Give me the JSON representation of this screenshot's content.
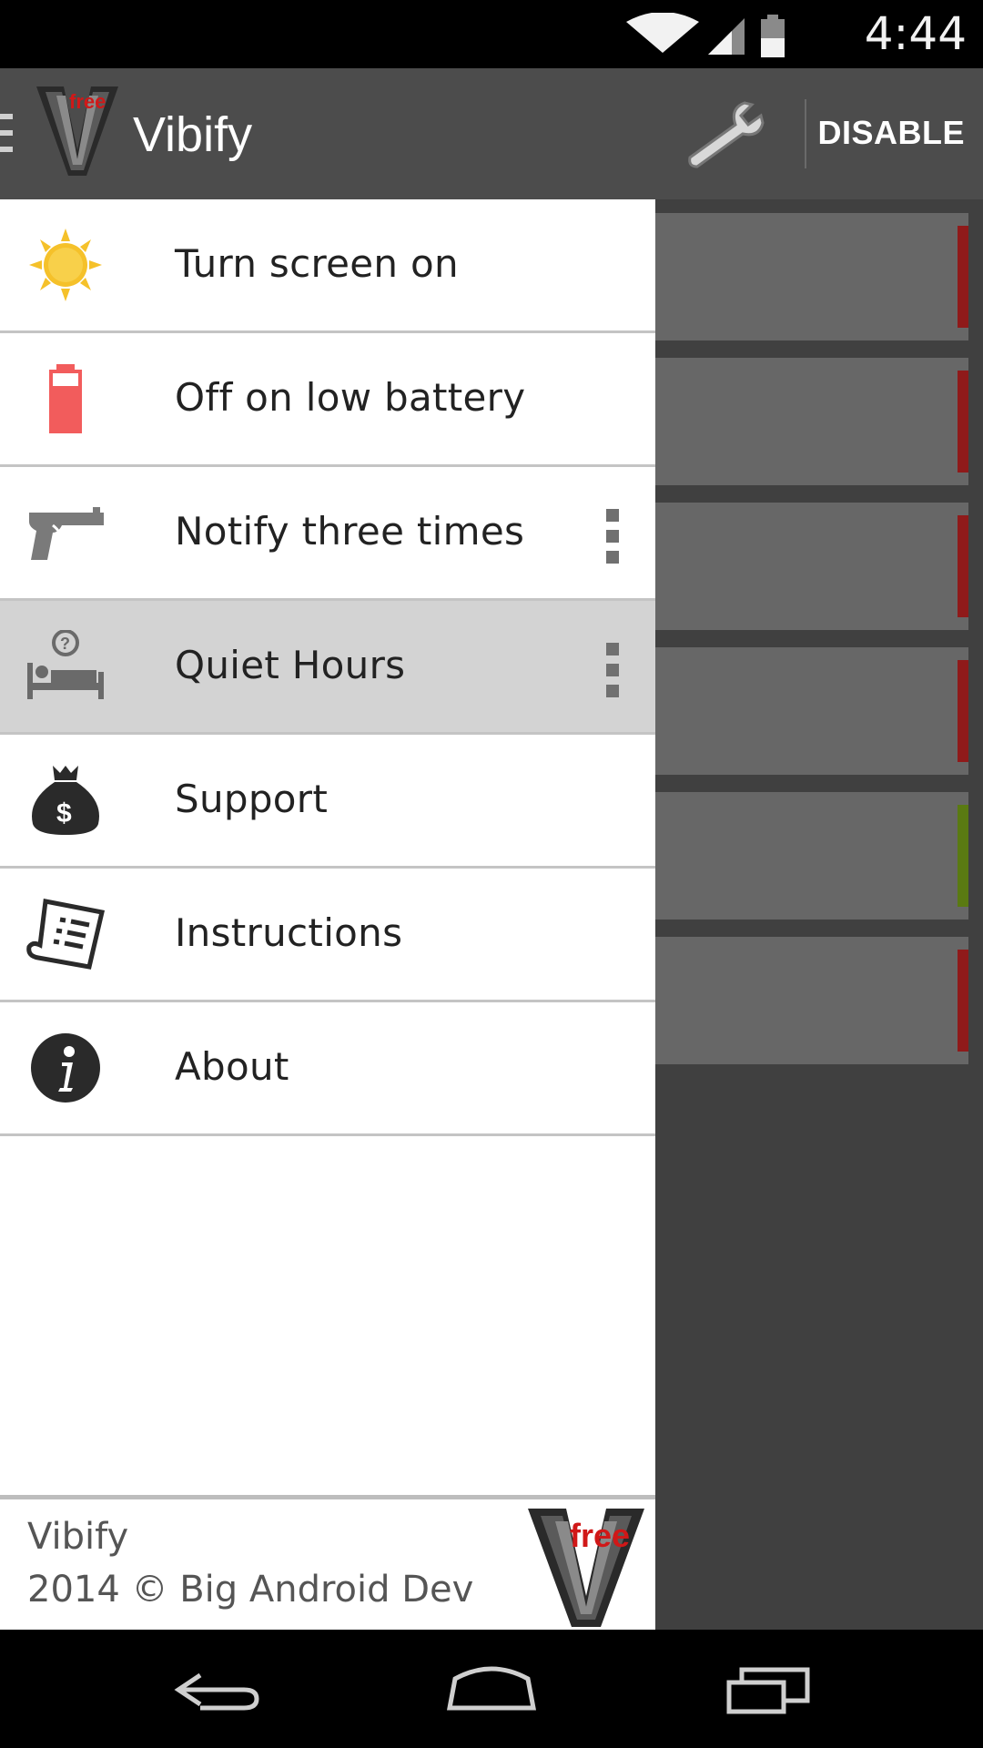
{
  "status_bar": {
    "time": "4:44",
    "icons": [
      "wifi-icon",
      "cell-signal-icon",
      "battery-icon"
    ]
  },
  "action_bar": {
    "title": "Vibify",
    "logo_badge": "free",
    "disable_label": "DISABLE",
    "icons": [
      "hamburger-icon",
      "app-logo-icon",
      "wrench-icon"
    ]
  },
  "drawer": {
    "items": [
      {
        "label": "Turn screen on",
        "icon": "sun-icon",
        "overflow": false,
        "selected": false
      },
      {
        "label": "Off on low battery",
        "icon": "low-battery-icon",
        "overflow": false,
        "selected": false
      },
      {
        "label": "Notify three times",
        "icon": "gun-icon",
        "overflow": true,
        "selected": false
      },
      {
        "label": "Quiet Hours",
        "icon": "bed-icon",
        "overflow": true,
        "selected": true
      },
      {
        "label": "Support",
        "icon": "money-bag-icon",
        "overflow": false,
        "selected": false
      },
      {
        "label": "Instructions",
        "icon": "scroll-icon",
        "overflow": false,
        "selected": false
      },
      {
        "label": "About",
        "icon": "info-icon",
        "overflow": false,
        "selected": false
      }
    ],
    "footer": {
      "app_name": "Vibify",
      "copyright": "2014 © Big Android Dev",
      "logo_badge": "free"
    }
  },
  "background_cards": {
    "accent_colors": [
      "#8f1a1a",
      "#8f1a1a",
      "#8f1a1a",
      "#8f1a1a",
      "#5a7a12",
      "#8f1a1a"
    ]
  },
  "nav_bar": {
    "icons": [
      "back-icon",
      "home-icon",
      "recents-icon"
    ]
  },
  "colors": {
    "action_bar": "#4c4c4c",
    "drawer_bg": "#ffffff",
    "selected_item": "#d3d3d3",
    "accent_red": "#8f1a1a",
    "accent_green": "#5a7a12"
  }
}
